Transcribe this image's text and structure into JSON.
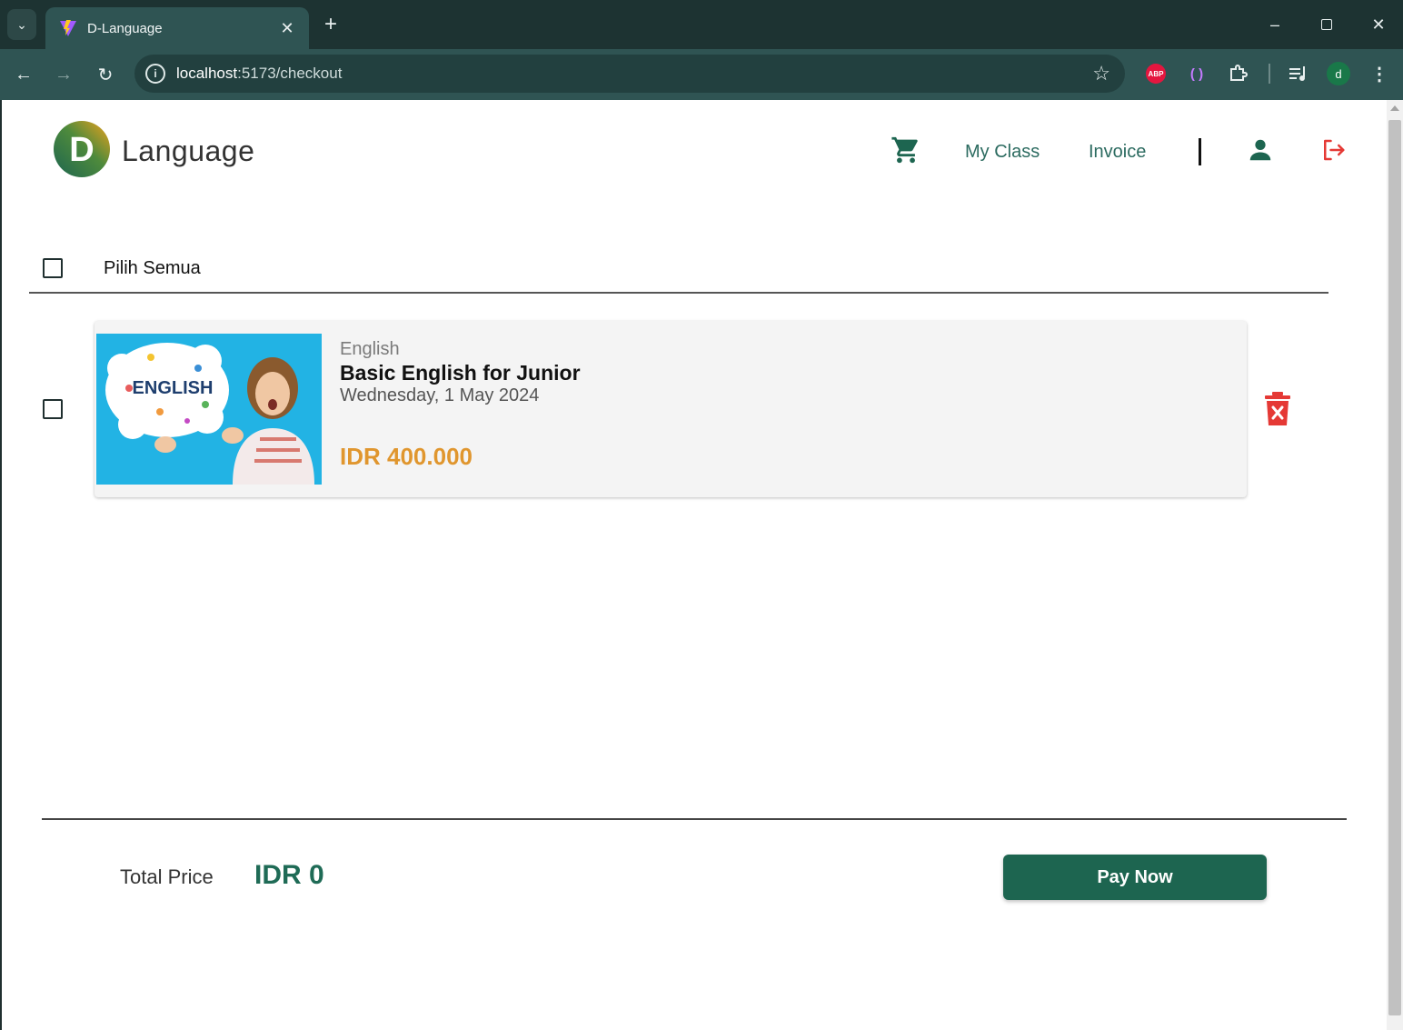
{
  "browser": {
    "tab_title": "D-Language",
    "url_host": "localhost",
    "url_path": ":5173/checkout",
    "profile_initial": "d",
    "abp_label": "ABP"
  },
  "header": {
    "brand_letter": "D",
    "brand_name": "Language",
    "nav": {
      "my_class": "My Class",
      "invoice": "Invoice"
    }
  },
  "checkout": {
    "select_all_label": "Pilih Semua",
    "items": [
      {
        "category": "English",
        "title": "Basic English for Junior",
        "date": "Wednesday, 1 May 2024",
        "price": "IDR 400.000",
        "image_text": "ENGLISH"
      }
    ],
    "total_label": "Total Price",
    "total_value": "IDR 0",
    "pay_label": "Pay Now"
  },
  "colors": {
    "primary": "#1d6550",
    "price": "#e0962e",
    "danger": "#e53935",
    "chrome": "#2f5453"
  }
}
